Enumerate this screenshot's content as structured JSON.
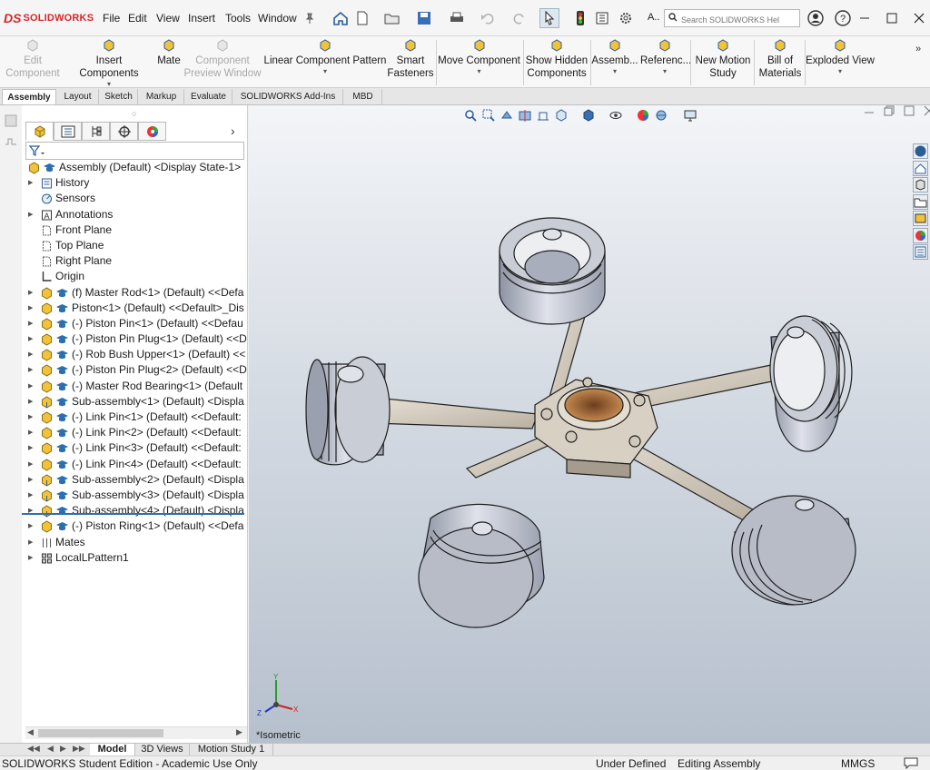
{
  "app": {
    "brand": "SOLIDWORKS",
    "brand_mark": "DS"
  },
  "menu": [
    "File",
    "Edit",
    "View",
    "Insert",
    "Tools",
    "Window"
  ],
  "search": {
    "placeholder": "Search SOLIDWORKS Hel"
  },
  "toolbar_truncated_label": "A..",
  "ribbon": [
    {
      "label": "Edit\nComponent",
      "disabled": true,
      "dropdown": false
    },
    {
      "label": "Insert Components",
      "disabled": false,
      "dropdown": true
    },
    {
      "label": "Mate",
      "disabled": false,
      "dropdown": false
    },
    {
      "label": "Component\nPreview Window",
      "disabled": true,
      "dropdown": false
    },
    {
      "label": "Linear Component Pattern",
      "disabled": false,
      "dropdown": true
    },
    {
      "label": "Smart\nFasteners",
      "disabled": false,
      "dropdown": false
    },
    {
      "label": "Move Component",
      "disabled": false,
      "dropdown": true
    },
    {
      "label": "Show Hidden\nComponents",
      "disabled": false,
      "dropdown": false
    },
    {
      "label": "Assemb...",
      "disabled": false,
      "dropdown": true
    },
    {
      "label": "Referenc...",
      "disabled": false,
      "dropdown": true
    },
    {
      "label": "New Motion\nStudy",
      "disabled": false,
      "dropdown": false
    },
    {
      "label": "Bill of\nMaterials",
      "disabled": false,
      "dropdown": false
    },
    {
      "label": "Exploded View",
      "disabled": false,
      "dropdown": true
    }
  ],
  "tabs": [
    "Assembly",
    "Layout",
    "Sketch",
    "Markup",
    "Evaluate",
    "SOLIDWORKS Add-Ins",
    "MBD"
  ],
  "active_tab": "Assembly",
  "tree": [
    {
      "label": "Assembly (Default) <Display State-1>",
      "expandable": false,
      "icon": "assembly-icon",
      "level": 0
    },
    {
      "label": "History",
      "expandable": true,
      "icon": "history-icon",
      "level": 1
    },
    {
      "label": "Sensors",
      "expandable": false,
      "icon": "sensor-icon",
      "level": 1
    },
    {
      "label": "Annotations",
      "expandable": true,
      "icon": "annotation-icon",
      "level": 1
    },
    {
      "label": "Front Plane",
      "expandable": false,
      "icon": "plane-icon",
      "level": 1
    },
    {
      "label": "Top Plane",
      "expandable": false,
      "icon": "plane-icon",
      "level": 1
    },
    {
      "label": "Right Plane",
      "expandable": false,
      "icon": "plane-icon",
      "level": 1
    },
    {
      "label": "Origin",
      "expandable": false,
      "icon": "origin-icon",
      "level": 1
    },
    {
      "label": "(f) Master Rod<1> (Default) <<Defa",
      "expandable": true,
      "icon": "part-icon",
      "level": 1
    },
    {
      "label": "Piston<1> (Default) <<Default>_Dis",
      "expandable": true,
      "icon": "part-icon",
      "level": 1
    },
    {
      "label": "(-) Piston Pin<1> (Default) <<Defau",
      "expandable": true,
      "icon": "part-icon",
      "level": 1
    },
    {
      "label": "(-) Piston Pin Plug<1> (Default) <<D",
      "expandable": true,
      "icon": "part-icon",
      "level": 1
    },
    {
      "label": "(-) Rob Bush Upper<1> (Default) <<",
      "expandable": true,
      "icon": "part-icon",
      "level": 1
    },
    {
      "label": "(-) Piston Pin Plug<2> (Default) <<D",
      "expandable": true,
      "icon": "part-icon",
      "level": 1
    },
    {
      "label": "(-) Master Rod Bearing<1> (Default",
      "expandable": true,
      "icon": "part-icon",
      "level": 1
    },
    {
      "label": "Sub-assembly<1> (Default) <Displa",
      "expandable": true,
      "icon": "subassembly-icon",
      "level": 1
    },
    {
      "label": "(-) Link Pin<1> (Default) <<Default:",
      "expandable": true,
      "icon": "part-icon",
      "level": 1
    },
    {
      "label": "(-) Link Pin<2> (Default) <<Default:",
      "expandable": true,
      "icon": "part-icon",
      "level": 1
    },
    {
      "label": "(-) Link Pin<3> (Default) <<Default:",
      "expandable": true,
      "icon": "part-icon",
      "level": 1
    },
    {
      "label": "(-) Link Pin<4> (Default) <<Default:",
      "expandable": true,
      "icon": "part-icon",
      "level": 1
    },
    {
      "label": "Sub-assembly<2> (Default) <Displa",
      "expandable": true,
      "icon": "subassembly-icon",
      "level": 1
    },
    {
      "label": "Sub-assembly<3> (Default) <Displa",
      "expandable": true,
      "icon": "subassembly-icon",
      "level": 1
    },
    {
      "label": "Sub-assembly<4> (Default) <Displa",
      "expandable": true,
      "icon": "subassembly-icon",
      "level": 1
    },
    {
      "label": "(-) Piston Ring<1> (Default) <<Defa",
      "expandable": true,
      "icon": "part-icon",
      "level": 1
    },
    {
      "label": "Mates",
      "expandable": true,
      "icon": "mates-icon",
      "level": 1
    },
    {
      "label": "LocalLPattern1",
      "expandable": true,
      "icon": "pattern-icon",
      "level": 1
    }
  ],
  "viewport": {
    "view_name": "*Isometric"
  },
  "bottom_tabs": [
    "Model",
    "3D Views",
    "Motion Study 1"
  ],
  "status": {
    "edition": "SOLIDWORKS Student Edition - Academic Use Only",
    "definition": "Under Defined",
    "mode": "Editing Assembly",
    "units": "MMGS"
  },
  "colors": {
    "brand_red": "#d6262b",
    "tree_accent": "#2e6fb0",
    "part_yellow": "#f2c23a",
    "piston_grey": "#c9cdd6",
    "rod_tan": "#d8d0c3",
    "bush_bronze": "#a86a3d"
  }
}
